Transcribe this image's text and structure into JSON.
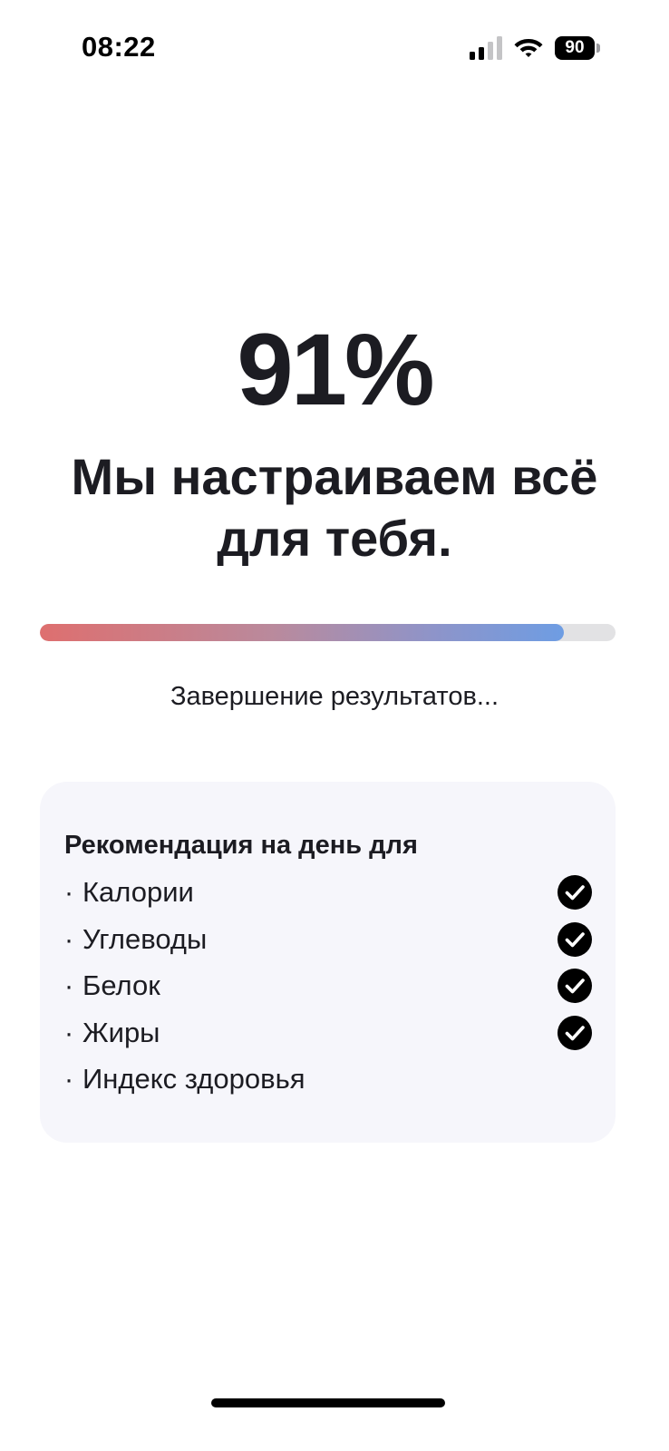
{
  "status_bar": {
    "time": "08:22",
    "battery_level": "90",
    "signal_icon": "cellular-signal-icon",
    "wifi_icon": "wifi-icon"
  },
  "progress": {
    "percent_label": "91%",
    "fraction": 0.91,
    "headline": "Мы настраиваем всё для тебя.",
    "status_text": "Завершение результатов...",
    "fill_gradient": [
      "#de6f6f",
      "#6e9de3"
    ],
    "track_color": "#e2e2e4"
  },
  "recommendation": {
    "title": "Рекомендация на день для",
    "bullet": "·",
    "check_icon": "checkmark-circle-icon",
    "items": [
      {
        "label": "Калории",
        "done": true
      },
      {
        "label": "Углеводы",
        "done": true
      },
      {
        "label": "Белок",
        "done": true
      },
      {
        "label": "Жиры",
        "done": true
      },
      {
        "label": "Индекс здоровья",
        "done": false
      }
    ]
  }
}
